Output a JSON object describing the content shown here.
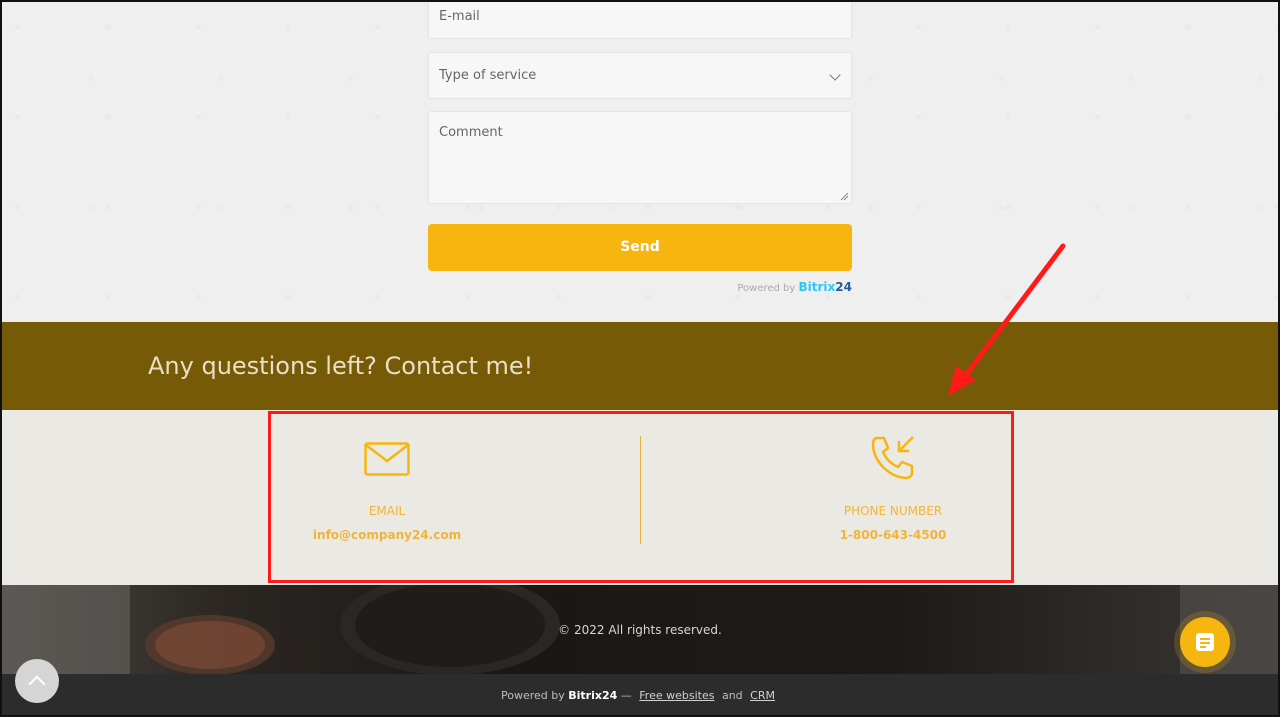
{
  "form": {
    "email_placeholder": "E-mail",
    "service_placeholder": "Type of service",
    "comment_placeholder": "Comment",
    "send_label": "Send",
    "powered_prefix": "Powered by",
    "powered_brand": "Bitrix",
    "powered_brand_num": "24"
  },
  "banner": {
    "title": "Any questions left? Contact me!"
  },
  "contacts": {
    "email": {
      "label": "EMAIL",
      "value": "info@company24.com"
    },
    "phone": {
      "label": "PHONE NUMBER",
      "value": "1-800-643-4500"
    }
  },
  "footer": {
    "copyright": "© 2022 All rights reserved.",
    "powered_prefix": "Powered by",
    "brand": "Bitrix24",
    "sep": "—",
    "link_free": "Free websites",
    "and": "and",
    "link_crm": "CRM"
  },
  "colors": {
    "accent": "#f7b50f",
    "banner": "#765a07",
    "highlight": "#ff1a1a"
  },
  "icons": {
    "email": "envelope-icon",
    "phone": "phone-incoming-icon",
    "chat": "chat-form-icon",
    "scroll": "chevron-up-icon"
  }
}
